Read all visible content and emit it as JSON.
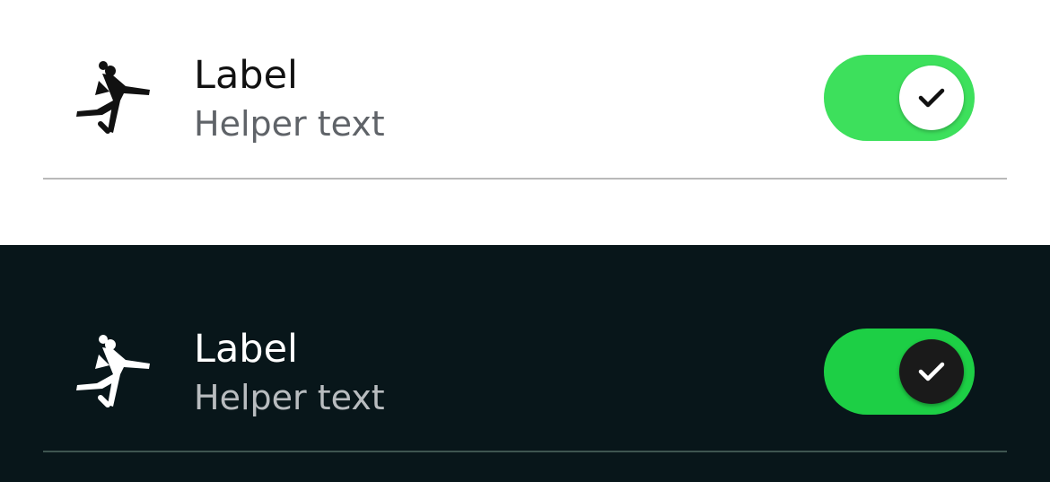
{
  "colors": {
    "light_background": "#ffffff",
    "dark_background": "#08161a",
    "light_switch_track": "#3de05c",
    "dark_switch_track": "#1dcf45",
    "light_knob": "#ffffff",
    "dark_knob": "#1a1a1a",
    "light_check": "#111111",
    "dark_check": "#ffffff"
  },
  "light": {
    "item": {
      "icon": "handball-player-icon",
      "label": "Label",
      "helper": "Helper text",
      "switch_on": true,
      "switch_knob_icon": "check-icon"
    }
  },
  "dark": {
    "item": {
      "icon": "handball-player-icon",
      "label": "Label",
      "helper": "Helper text",
      "switch_on": true,
      "switch_knob_icon": "check-icon"
    }
  }
}
